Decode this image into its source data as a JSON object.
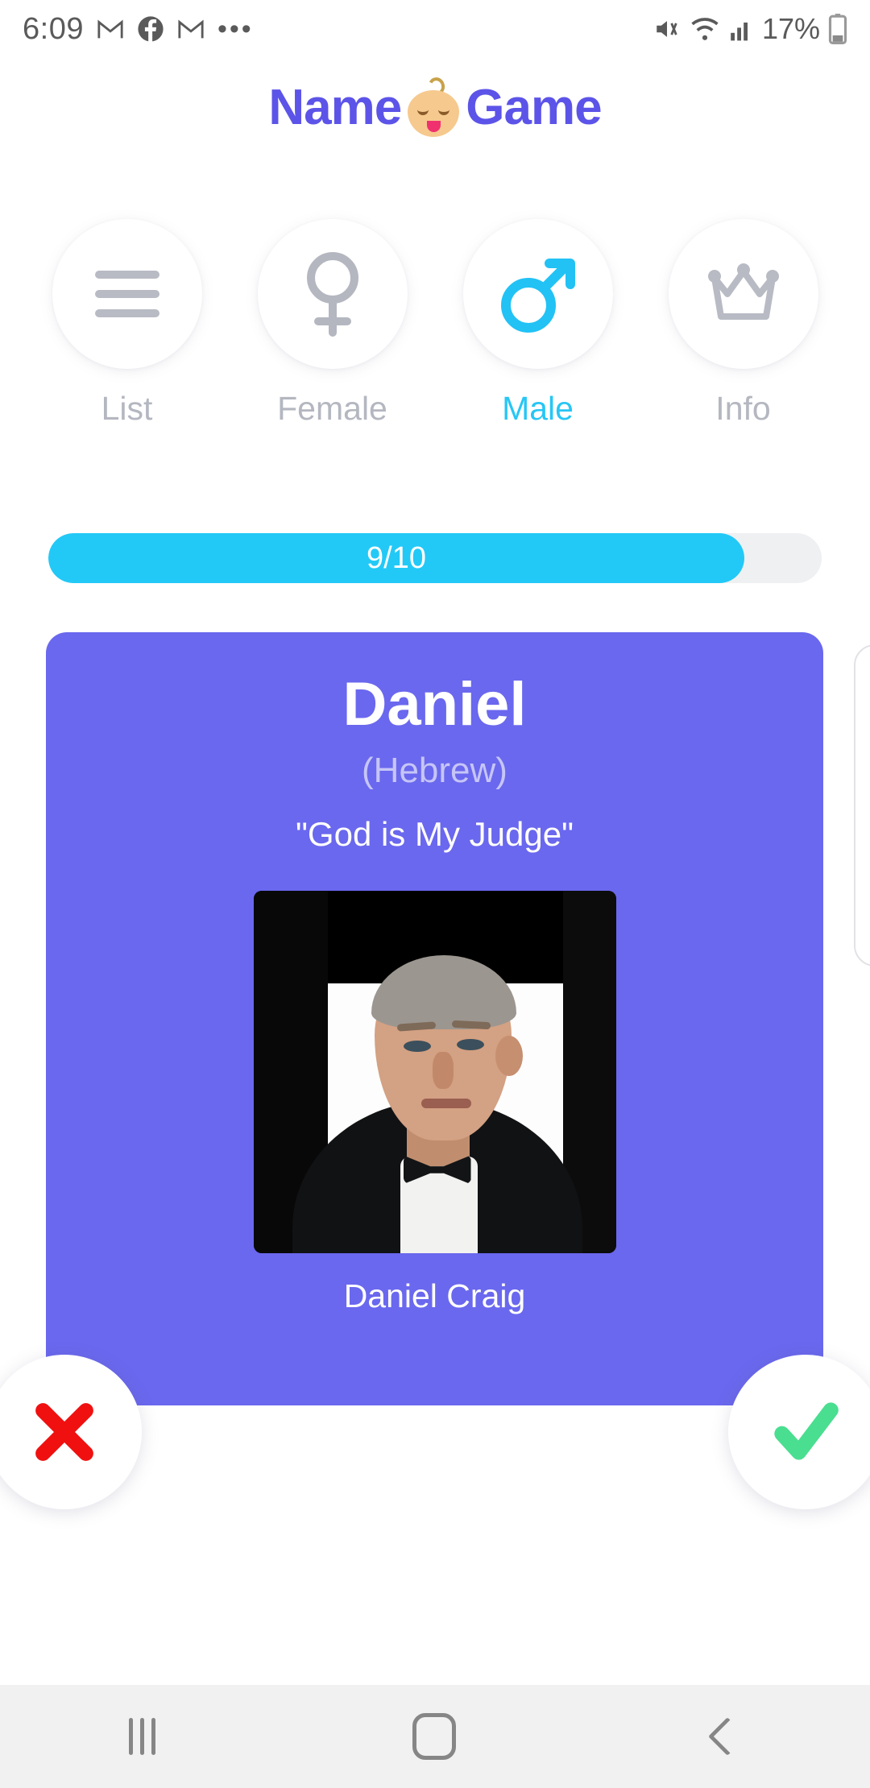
{
  "status_bar": {
    "time": "6:09",
    "left_icons": [
      "gmail-icon",
      "facebook-icon",
      "gmail-icon",
      "overflow-dots-icon"
    ],
    "right_icons": [
      "mute-icon",
      "wifi-icon",
      "cellular-signal-icon"
    ],
    "battery_percent": "17%"
  },
  "logo": {
    "text_left": "Name",
    "text_right": "Game",
    "mascot": "baby-face-icon",
    "color": "#5c54e8"
  },
  "nav": {
    "items": [
      {
        "label": "List",
        "icon": "hamburger-menu-icon",
        "active": false
      },
      {
        "label": "Female",
        "icon": "female-gender-icon",
        "active": false
      },
      {
        "label": "Male",
        "icon": "male-gender-icon",
        "active": true
      },
      {
        "label": "Info",
        "icon": "crown-icon",
        "active": false
      }
    ],
    "active_color": "#27c6f5",
    "inactive_color": "#b4b7c0"
  },
  "progress": {
    "label": "9/10",
    "current": 9,
    "total": 10,
    "fill_color": "#22c9f7",
    "track_color": "#eff0f2"
  },
  "card": {
    "name": "Daniel",
    "origin": "(Hebrew)",
    "meaning": "\"God is My Judge\"",
    "celebrity_caption": "Daniel Craig",
    "photo": "daniel-craig-portrait",
    "background_color": "#6a68ee"
  },
  "actions": {
    "reject": {
      "icon": "cross-icon",
      "color": "#f01010"
    },
    "accept": {
      "icon": "check-icon",
      "color": "#4ade90"
    }
  },
  "android_nav": {
    "recents": "recents-icon",
    "home": "home-icon",
    "back": "back-icon"
  }
}
